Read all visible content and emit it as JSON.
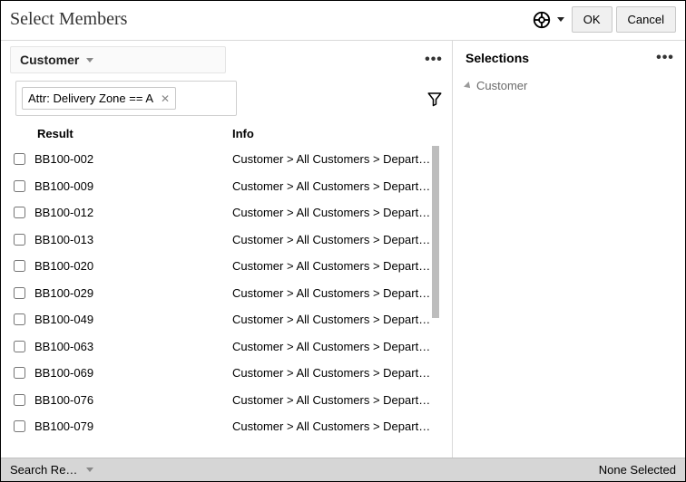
{
  "header": {
    "title": "Select Members",
    "ok_label": "OK",
    "cancel_label": "Cancel"
  },
  "left": {
    "dimension_label": "Customer",
    "filter_chip": "Attr: Delivery Zone == A",
    "columns": {
      "result": "Result",
      "info": "Info"
    },
    "rows": [
      {
        "label": "BB100-002",
        "info": "Customer > All Customers > Depart…"
      },
      {
        "label": "BB100-009",
        "info": "Customer > All Customers > Depart…"
      },
      {
        "label": "BB100-012",
        "info": "Customer > All Customers > Depart…"
      },
      {
        "label": "BB100-013",
        "info": "Customer > All Customers > Depart…"
      },
      {
        "label": "BB100-020",
        "info": "Customer > All Customers > Depart…"
      },
      {
        "label": "BB100-029",
        "info": "Customer > All Customers > Depart…"
      },
      {
        "label": "BB100-049",
        "info": "Customer > All Customers > Depart…"
      },
      {
        "label": "BB100-063",
        "info": "Customer > All Customers > Depart…"
      },
      {
        "label": "BB100-069",
        "info": "Customer > All Customers > Depart…"
      },
      {
        "label": "BB100-076",
        "info": "Customer > All Customers > Depart…"
      },
      {
        "label": "BB100-079",
        "info": "Customer > All Customers > Depart…"
      }
    ]
  },
  "right": {
    "title": "Selections",
    "tree_root": "Customer"
  },
  "footer": {
    "left": "Search Res…",
    "right": "None Selected"
  }
}
